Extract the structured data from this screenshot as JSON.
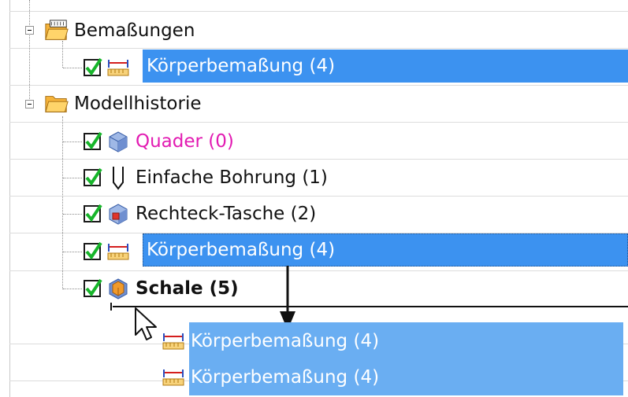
{
  "tree": {
    "dimensions_folder": {
      "label": "Bemaßungen"
    },
    "dimensions_child": {
      "label": "Körperbemaßung (4)"
    },
    "history_folder": {
      "label": "Modellhistorie"
    },
    "history_items": [
      {
        "label": "Quader (0)"
      },
      {
        "label": "Einfache Bohrung (1)"
      },
      {
        "label": "Rechteck-Tasche (2)"
      },
      {
        "label": "Körperbemaßung (4)"
      },
      {
        "label": "Schale (5)"
      }
    ]
  },
  "drag_preview": {
    "items": [
      {
        "label": "Körperbemaßung (4)"
      },
      {
        "label": "Körperbemaßung (4)"
      }
    ]
  },
  "colors": {
    "selection": "#3c92f0",
    "drag_selection": "#6aaef2",
    "quader_text": "#e21bb2",
    "check_green": "#17b52a"
  }
}
